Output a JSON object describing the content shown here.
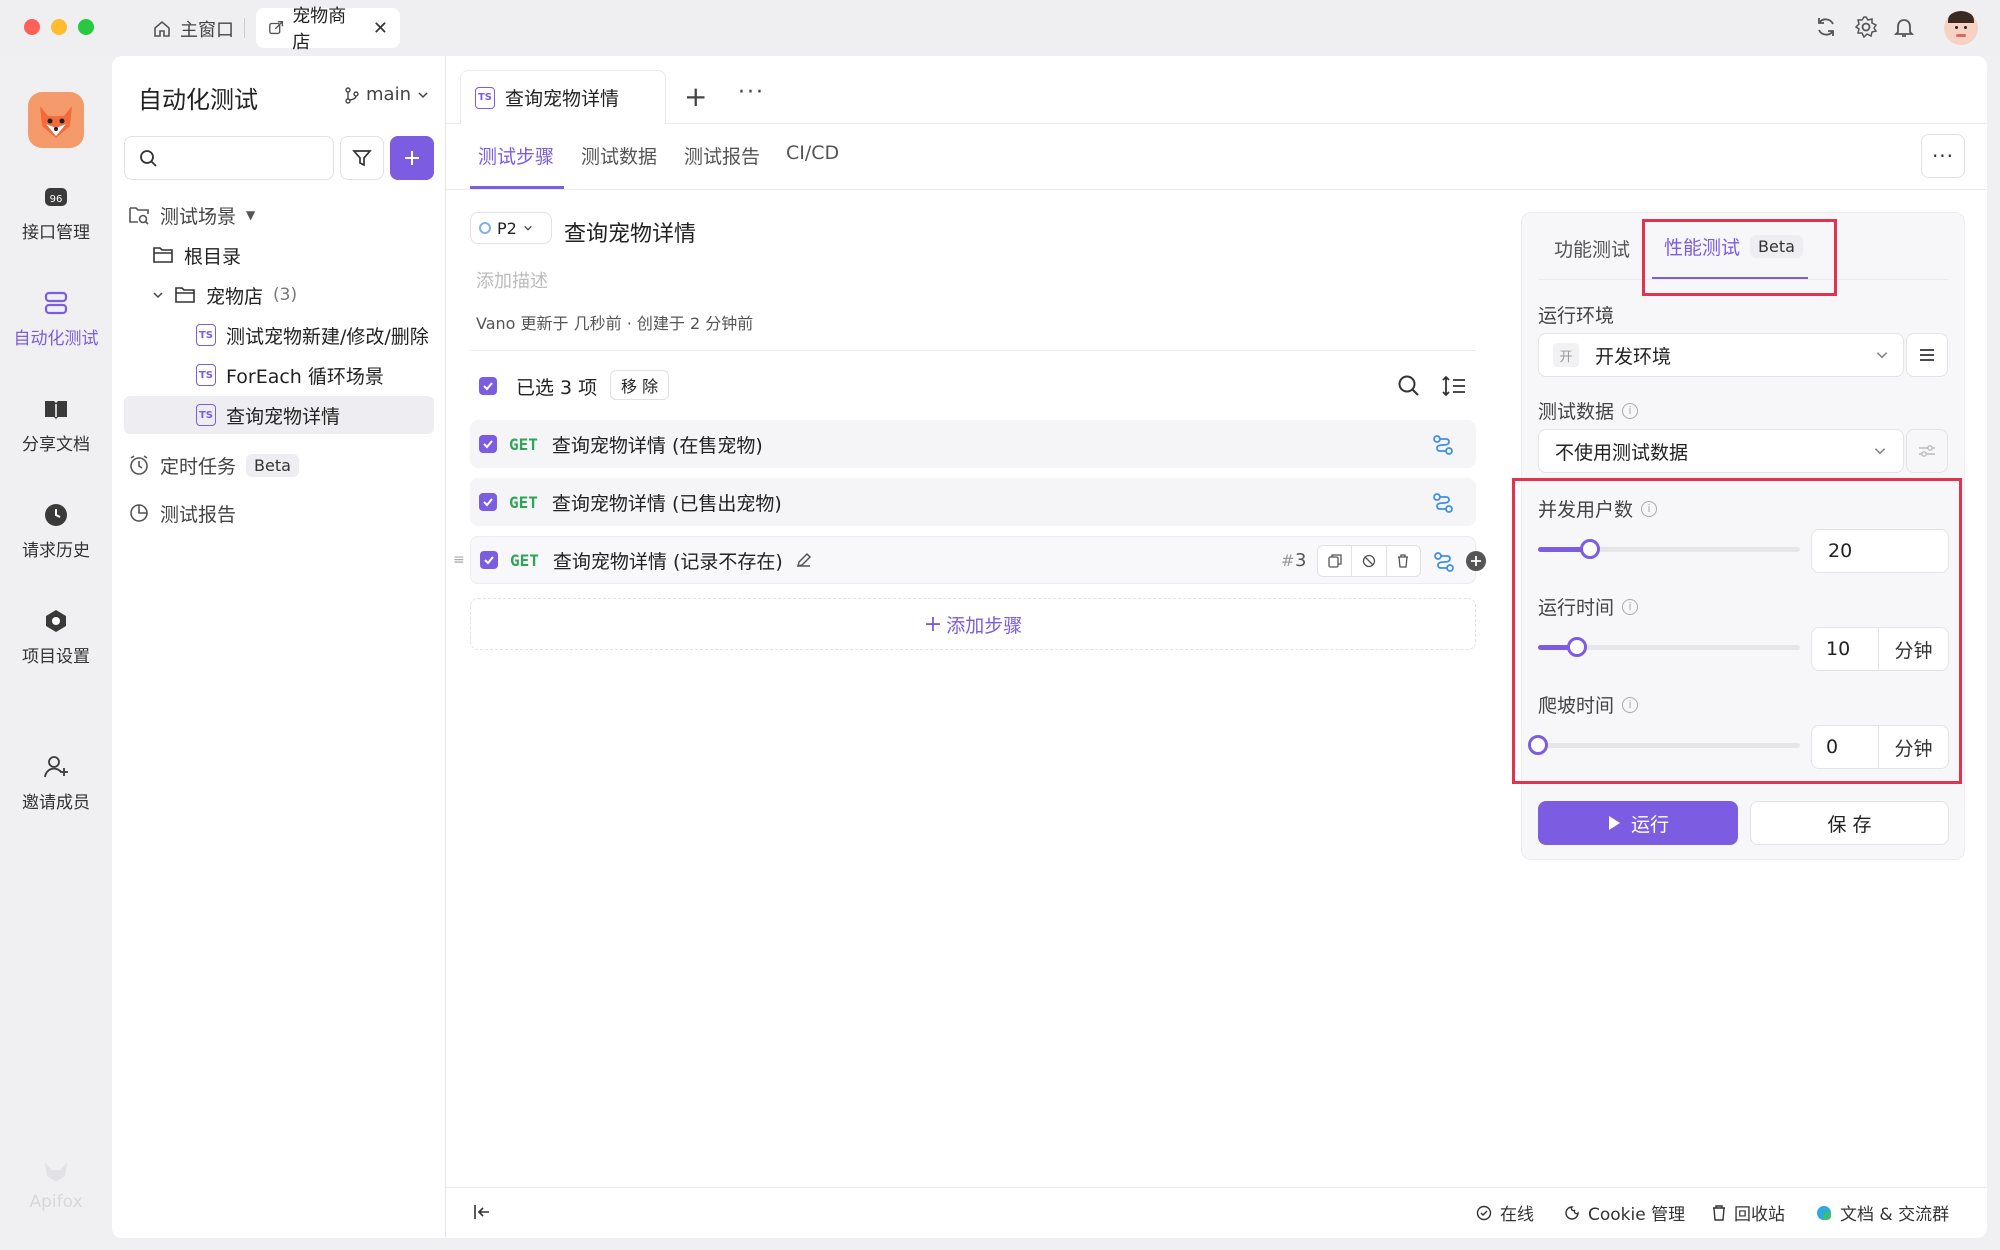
{
  "window": {
    "home_tab": "主窗口",
    "active_tab": "宠物商店"
  },
  "nav": {
    "items": [
      {
        "label": "接口管理",
        "icon": "api-icon"
      },
      {
        "label": "自动化测试",
        "icon": "automation-icon"
      },
      {
        "label": "分享文档",
        "icon": "book-icon"
      },
      {
        "label": "请求历史",
        "icon": "history-icon"
      },
      {
        "label": "项目设置",
        "icon": "settings-icon"
      },
      {
        "label": "邀请成员",
        "icon": "invite-icon"
      }
    ],
    "brand": "Apifox"
  },
  "tree": {
    "title": "自动化测试",
    "branch": "main",
    "scenes_label": "测试场景",
    "root": "根目录",
    "folder": "宠物店",
    "folder_count": "(3)",
    "items": [
      "测试宠物新建/修改/删除",
      "ForEach 循环场景",
      "查询宠物详情"
    ],
    "scheduled": "定时任务",
    "scheduled_badge": "Beta",
    "reports": "测试报告"
  },
  "editor": {
    "tab_title": "查询宠物详情",
    "subtabs": [
      "测试步骤",
      "测试数据",
      "测试报告",
      "CI/CD"
    ],
    "priority": "P2",
    "title": "查询宠物详情",
    "desc_placeholder": "添加描述",
    "meta": "Vano 更新于 几秒前 · 创建于 2 分钟前",
    "selected_text": "已选 3 项",
    "remove": "移 除",
    "steps": [
      {
        "method": "GET",
        "name": "查询宠物详情 (在售宠物)"
      },
      {
        "method": "GET",
        "name": "查询宠物详情 (已售出宠物)"
      },
      {
        "method": "GET",
        "name": "查询宠物详情 (记录不存在)"
      }
    ],
    "step_index": "3",
    "add_step": "添加步骤"
  },
  "perf": {
    "tab_func": "功能测试",
    "tab_perf": "性能测试",
    "tab_badge": "Beta",
    "env_label": "运行环境",
    "env_tag": "开",
    "env_value": "开发环境",
    "data_label": "测试数据",
    "data_value": "不使用测试数据",
    "users_label": "并发用户数",
    "users_value": "20",
    "users_fraction": 0.2,
    "time_label": "运行时间",
    "time_value": "10",
    "time_unit": "分钟",
    "time_fraction": 0.15,
    "ramp_label": "爬坡时间",
    "ramp_value": "0",
    "ramp_unit": "分钟",
    "ramp_fraction": 0,
    "run": "运行",
    "save": "保 存"
  },
  "status": {
    "online": "在线",
    "cookie": "Cookie 管理",
    "trash": "回收站",
    "docs": "文档 & 交流群"
  },
  "colors": {
    "accent": "#7c5ce0",
    "highlight": "#e0334f",
    "get": "#2fa55a"
  }
}
